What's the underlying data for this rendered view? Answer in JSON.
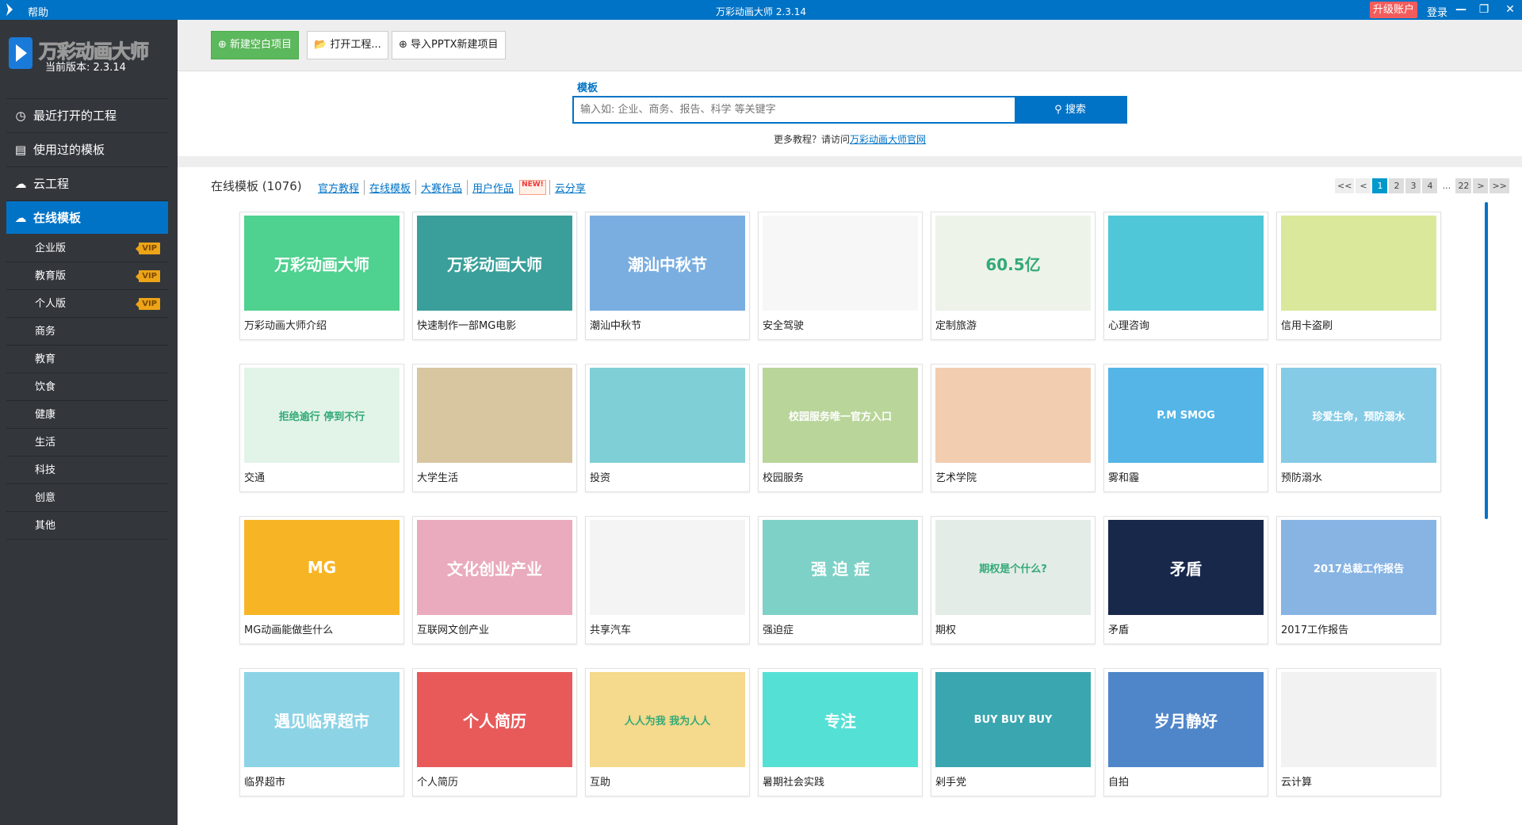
{
  "titlebar": {
    "help": "帮助",
    "title": "万彩动画大师 2.3.14",
    "upgrade": "升级账户",
    "login": "登录",
    "minimize": "—",
    "restore": "❐",
    "close": "✕"
  },
  "sidebar": {
    "brand": "万彩动画大师",
    "version": "当前版本: 2.3.14",
    "nav": [
      {
        "label": "最近打开的工程",
        "icon": "◷"
      },
      {
        "label": "使用过的模板",
        "icon": "▤"
      },
      {
        "label": "云工程",
        "icon": "☁"
      },
      {
        "label": "在线模板",
        "icon": "☁"
      }
    ],
    "sub": [
      {
        "label": "企业版",
        "badge": "VIP"
      },
      {
        "label": "教育版",
        "badge": "VIP"
      },
      {
        "label": "个人版",
        "badge": "VIP"
      },
      {
        "label": "商务"
      },
      {
        "label": "教育"
      },
      {
        "label": "饮食"
      },
      {
        "label": "健康"
      },
      {
        "label": "生活"
      },
      {
        "label": "科技"
      },
      {
        "label": "创意"
      },
      {
        "label": "其他"
      }
    ]
  },
  "toolbar": {
    "new_blank": "新建空白项目",
    "open": "打开工程...",
    "import_pptx": "导入PPTX新建项目"
  },
  "search": {
    "tab": "模板",
    "placeholder": "输入如: 企业、商务、报告、科学 等关键字",
    "button": "搜索",
    "more_text": "更多教程？请访问",
    "more_link": "万彩动画大师官网"
  },
  "content": {
    "title": "在线模板 (1076)",
    "links": [
      "官方教程",
      "在线模板",
      "大赛作品",
      "用户作品",
      "云分享"
    ],
    "new_badge": "NEW!",
    "pager": [
      "<<",
      "<",
      "1",
      "2",
      "3",
      "4",
      "...",
      "22",
      ">",
      ">>"
    ],
    "current_page": "1",
    "cards": [
      {
        "name": "万彩动画大师介绍",
        "color": "#4fd18f",
        "text": "万彩动画大师"
      },
      {
        "name": "快速制作一部MG电影",
        "color": "#3a9f9a",
        "text": "万彩动画大师"
      },
      {
        "name": "潮汕中秋节",
        "color": "#7aaee0",
        "text": "潮汕中秋节"
      },
      {
        "name": "安全驾驶",
        "color": "#f7f7f7",
        "text": ""
      },
      {
        "name": "定制旅游",
        "color": "#eef3ea",
        "text": "60.5亿"
      },
      {
        "name": "心理咨询",
        "color": "#4fc7d8",
        "text": ""
      },
      {
        "name": "信用卡盗刷",
        "color": "#d9e89a",
        "text": ""
      },
      {
        "name": "交通",
        "color": "#e2f3e8",
        "text": "拒绝逾行 停到不行"
      },
      {
        "name": "大学生活",
        "color": "#d7c6a0",
        "text": ""
      },
      {
        "name": "投资",
        "color": "#7fcfd6",
        "text": ""
      },
      {
        "name": "校园服务",
        "color": "#b9d59a",
        "text": "校园服务唯一官方入口"
      },
      {
        "name": "艺术学院",
        "color": "#f3cdb0",
        "text": ""
      },
      {
        "name": "雾和霾",
        "color": "#55b5e6",
        "text": "P.M SMOG"
      },
      {
        "name": "预防溺水",
        "color": "#85cbe6",
        "text": "珍爱生命，预防溺水"
      },
      {
        "name": "MG动画能做些什么",
        "color": "#f7b526",
        "text": "MG"
      },
      {
        "name": "互联网文创产业",
        "color": "#e9abbd",
        "text": "文化创业产业"
      },
      {
        "name": "共享汽车",
        "color": "#f4f4f4",
        "text": ""
      },
      {
        "name": "强迫症",
        "color": "#7ed1c6",
        "text": "强 迫 症"
      },
      {
        "name": "期权",
        "color": "#e4ece8",
        "text": "期权是个什么?"
      },
      {
        "name": "矛盾",
        "color": "#17284b",
        "text": "矛盾"
      },
      {
        "name": "2017工作报告",
        "color": "#88b4e3",
        "text": "2017总裁工作报告"
      },
      {
        "name": "临界超市",
        "color": "#8cd3e6",
        "text": "遇见临界超市"
      },
      {
        "name": "个人简历",
        "color": "#e85a5a",
        "text": "个人简历"
      },
      {
        "name": "互助",
        "color": "#f5d98c",
        "text": "人人为我 我为人人"
      },
      {
        "name": "暑期社会实践",
        "color": "#55e0d5",
        "text": "专注"
      },
      {
        "name": "剁手党",
        "color": "#3aa6b0",
        "text": "BUY BUY BUY"
      },
      {
        "name": "自拍",
        "color": "#4f86c9",
        "text": "岁月静好"
      },
      {
        "name": "云计算",
        "color": "#f2f2f2",
        "text": ""
      }
    ]
  }
}
